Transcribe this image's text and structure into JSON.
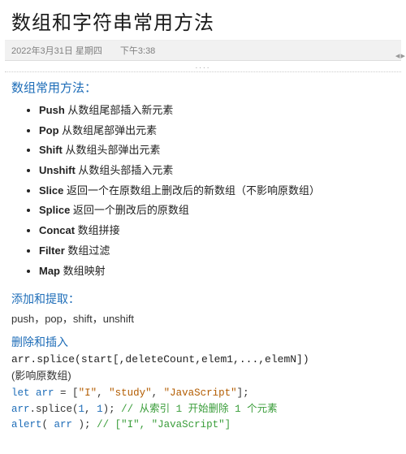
{
  "title": "数组和字符串常用方法",
  "meta": {
    "date": "2022年3月31日 星期四",
    "time": "下午3:38"
  },
  "ellipsis": "....",
  "scroll_indicator": "◂ ▸",
  "section1": {
    "heading": "数组常用方法：",
    "items": [
      {
        "name": "Push",
        "desc": " 从数组尾部插入新元素"
      },
      {
        "name": "Pop",
        "desc": " 从数组尾部弹出元素"
      },
      {
        "name": "Shift",
        "desc": " 从数组头部弹出元素"
      },
      {
        "name": "Unshift",
        "desc": " 从数组头部插入元素"
      },
      {
        "name": "Slice",
        "desc": " 返回一个在原数组上删改后的新数组（不影响原数组）"
      },
      {
        "name": "Splice",
        "desc": " 返回一个删改后的原数组"
      },
      {
        "name": "Concat",
        "desc": " 数组拼接"
      },
      {
        "name": "Filter",
        "desc": " 数组过滤"
      },
      {
        "name": "Map",
        "desc": " 数组映射"
      }
    ]
  },
  "section2": {
    "heading": "添加和提取：",
    "line": "push，pop，shift，unshift"
  },
  "section3": {
    "heading": "删除和插入",
    "signature": "arr.splice(start[,deleteCount,elem1,...,elemN])",
    "note": "(影响原数组)",
    "code": {
      "kw_let": "let",
      "var_arr": "arr",
      "eq": " = [",
      "s1": "\"I\"",
      "s2": "\"study\"",
      "s3": "\"JavaScript\"",
      "arr_close": "];",
      "obj": "arr",
      "dot_splice": ".splice(",
      "n1": "1",
      "n2": "1",
      "call_close": ");",
      "c1": " // 从索引 1 开始删除 1 个元素",
      "alert": "alert",
      "alert_open": "( ",
      "alert_arg": "arr",
      "alert_close": " );",
      "c2": " // [\"I\", \"JavaScript\"]"
    }
  }
}
